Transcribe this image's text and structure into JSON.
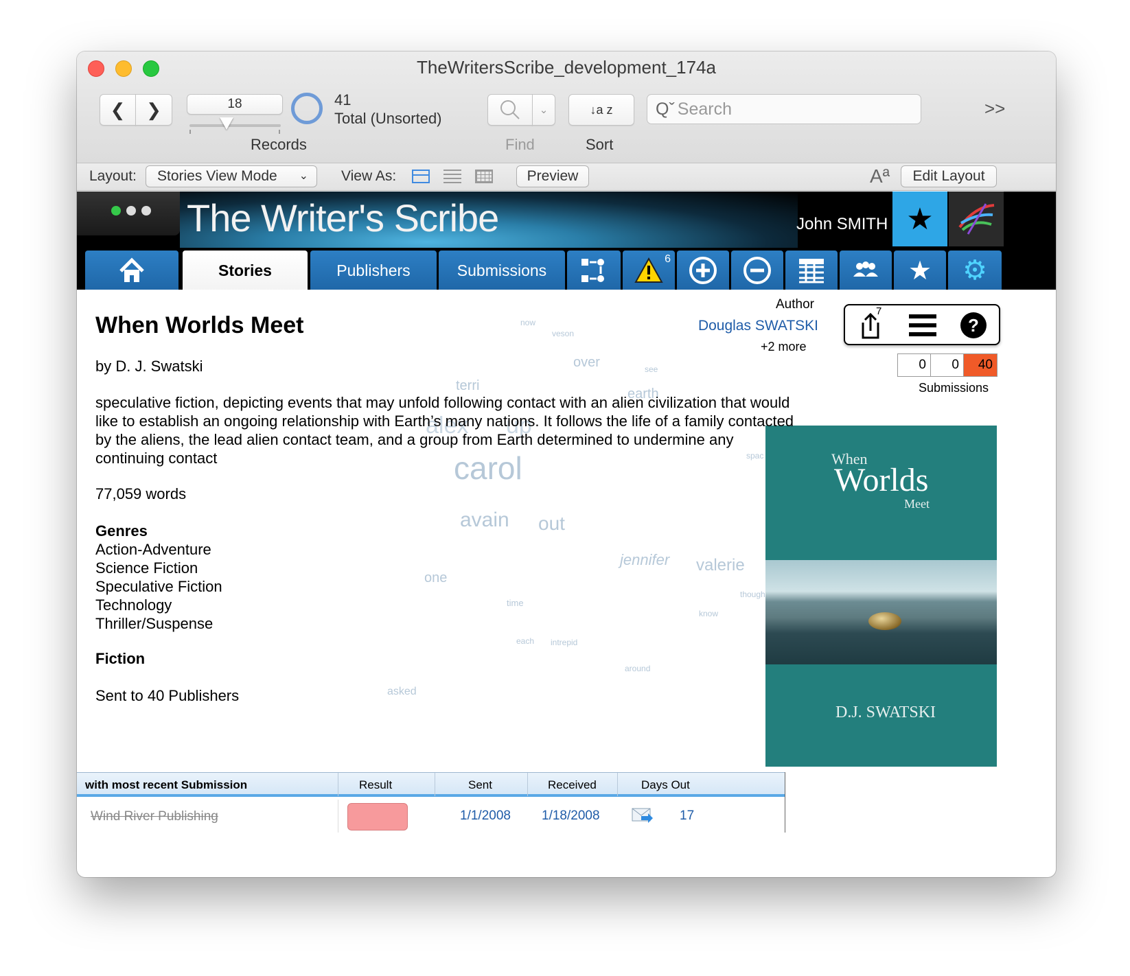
{
  "window": {
    "title": "TheWritersScribe_development_174a"
  },
  "toolbar": {
    "record_number": "18",
    "found_count": "41",
    "found_label": "Total (Unsorted)",
    "records_label": "Records",
    "find_label": "Find",
    "sort_label": "Sort",
    "sort_icon": "↓a z",
    "search_placeholder": "Search",
    "overflow_icon": ">>"
  },
  "layout_bar": {
    "layout_label": "Layout:",
    "layout_value": "Stories View Mode",
    "viewas_label": "View As:",
    "preview_label": "Preview",
    "font_icon": "Aª",
    "edit_layout_label": "Edit Layout"
  },
  "header": {
    "brand": "The Writer's Scribe",
    "user_name": "John SMITH"
  },
  "tabs": [
    {
      "label": "Stories",
      "active": true
    },
    {
      "label": "Publishers",
      "active": false
    },
    {
      "label": "Submissions",
      "active": false
    }
  ],
  "icon_tabs": {
    "alert_badge": "6"
  },
  "story": {
    "title": "When Worlds Meet",
    "byline": "by D. J. Swatski",
    "synopsis": "speculative fiction, depicting events that may unfold following contact with an alien civilization that would like to establish an ongoing relationship with Earth’s many nations. It follows the life of a family contacted by the aliens, the lead alien contact team, and a group from Earth determined to undermine any continuing contact",
    "word_count": "77,059 words",
    "genres_title": "Genres",
    "genres": [
      "Action-Adventure",
      "Science Fiction",
      "Speculative Fiction",
      "Technology",
      "Thriller/Suspense"
    ],
    "category": "Fiction",
    "sent_to": "Sent to 40 Publishers"
  },
  "author": {
    "label": "Author",
    "name": "Douglas SWATSKI",
    "more": "+2 more"
  },
  "actions": {
    "share_badge": "7"
  },
  "submission_counts": {
    "a": "0",
    "b": "0",
    "total": "40",
    "label": "Submissions",
    "total_color": "#f05a28"
  },
  "word_cloud": [
    "now",
    "veson",
    "over",
    "see",
    "terri",
    "earth",
    "alex",
    "up",
    "carol",
    "spac",
    "avain",
    "out",
    "jennifer",
    "valerie",
    "one",
    "time",
    "though",
    "know",
    "each",
    "intrepid",
    "around",
    "asked"
  ],
  "cover": {
    "when": "When",
    "worlds": "Worlds",
    "meet": "Meet",
    "author": "D.J. SWATSKI",
    "color": "#237f7d"
  },
  "submission_table": {
    "headers": {
      "publisher": "with most recent Submission",
      "result": "Result",
      "sent": "Sent",
      "received": "Received",
      "days_out": "Days Out"
    },
    "rows": [
      {
        "publisher": "Wind River Publishing",
        "result_color": "#f79a9c",
        "sent": "1/1/2008",
        "received": "1/18/2008",
        "days_out": "17"
      }
    ]
  }
}
